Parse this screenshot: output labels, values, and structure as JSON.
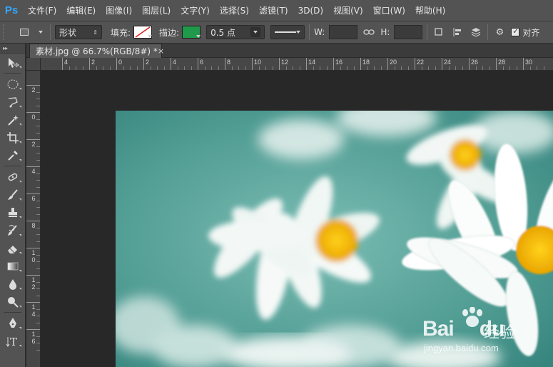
{
  "app": {
    "logo": "Ps"
  },
  "menu": [
    "文件(F)",
    "编辑(E)",
    "图像(I)",
    "图层(L)",
    "文字(Y)",
    "选择(S)",
    "滤镜(T)",
    "3D(D)",
    "视图(V)",
    "窗口(W)",
    "帮助(H)"
  ],
  "options": {
    "mode": "形状",
    "fill_label": "填充:",
    "stroke_label": "描边:",
    "stroke_color": "#1f9a4b",
    "stroke_width": "0.5 点",
    "w_label": "W:",
    "h_label": "H:",
    "align_label": "对齐"
  },
  "document": {
    "tab_title": "素材.jpg @ 66.7%(RGB/8#) *",
    "close": "×"
  },
  "rulers": {
    "horizontal_labels": [
      "4",
      "2",
      "0",
      "2",
      "4",
      "6",
      "8",
      "10",
      "12",
      "14",
      "16",
      "18",
      "20",
      "22",
      "24",
      "26",
      "28",
      "30"
    ],
    "vertical_labels": [
      "2",
      "0",
      "2",
      "4",
      "6",
      "8",
      "10",
      "12",
      "14",
      "16"
    ]
  },
  "watermark": {
    "brand": "Bai",
    "brand2": "du",
    "cn": "经验",
    "url": "jingyan.baidu.com"
  }
}
